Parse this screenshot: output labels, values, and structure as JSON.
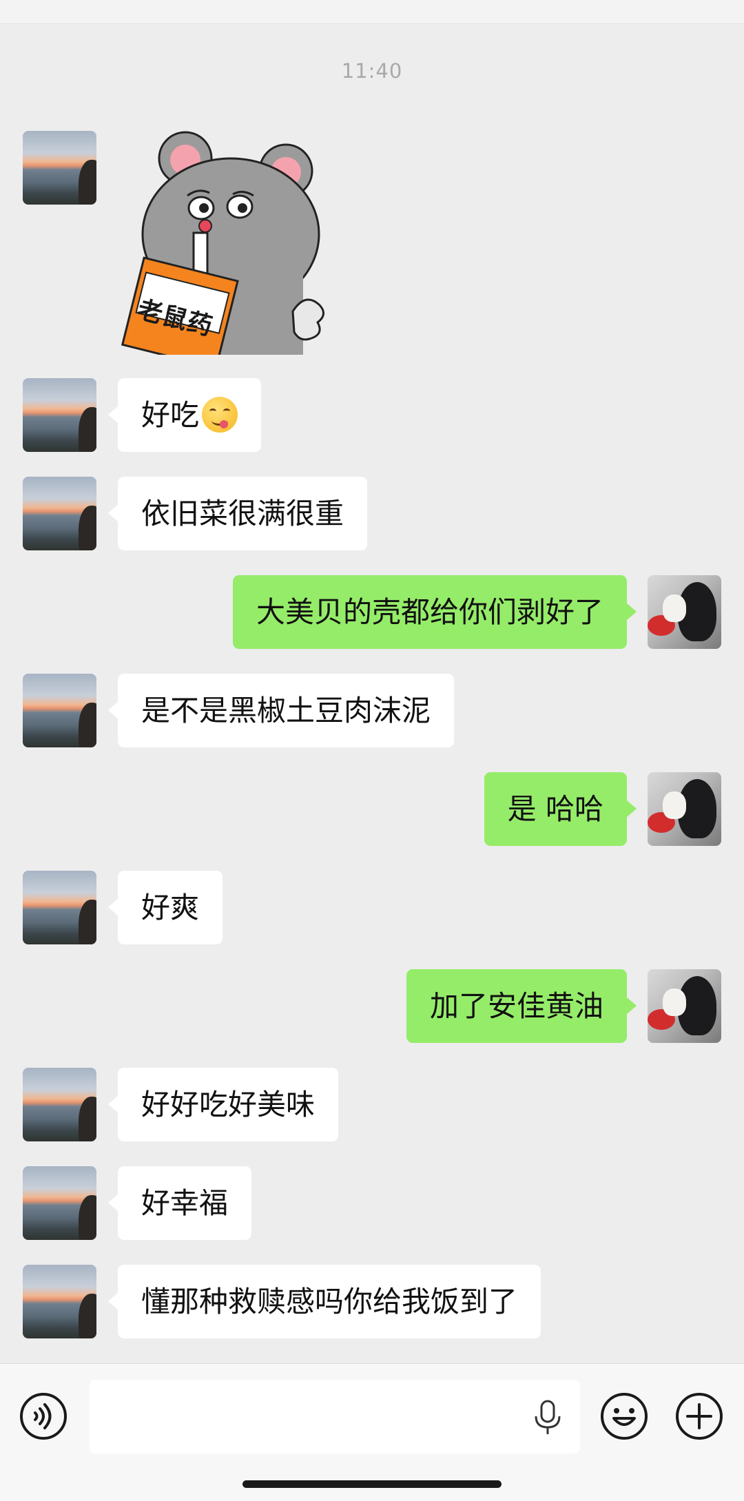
{
  "timestamp": "11:40",
  "sticker": {
    "label": "老鼠药",
    "icon": "mouse-sticker"
  },
  "messages": [
    {
      "side": "them",
      "text": "好吃"
    },
    {
      "side": "them",
      "text": "依旧菜很满很重"
    },
    {
      "side": "me",
      "text": "大美贝的壳都给你们剥好了"
    },
    {
      "side": "them",
      "text": "是不是黑椒土豆肉沫泥"
    },
    {
      "side": "me",
      "text": "是 哈哈"
    },
    {
      "side": "them",
      "text": "好爽"
    },
    {
      "side": "me",
      "text": "加了安佳黄油"
    },
    {
      "side": "them",
      "text": "好好吃好美味"
    },
    {
      "side": "them",
      "text": "好幸福"
    },
    {
      "side": "them",
      "text": "懂那种救赎感吗你给我饭到了"
    }
  ],
  "input_bar": {
    "text": "",
    "icons": [
      "voice-icon",
      "mic-icon",
      "emoji-icon",
      "plus-icon"
    ]
  },
  "colors": {
    "background": "#ededed",
    "own_bubble": "#95ec69",
    "other_bubble": "#ffffff"
  }
}
